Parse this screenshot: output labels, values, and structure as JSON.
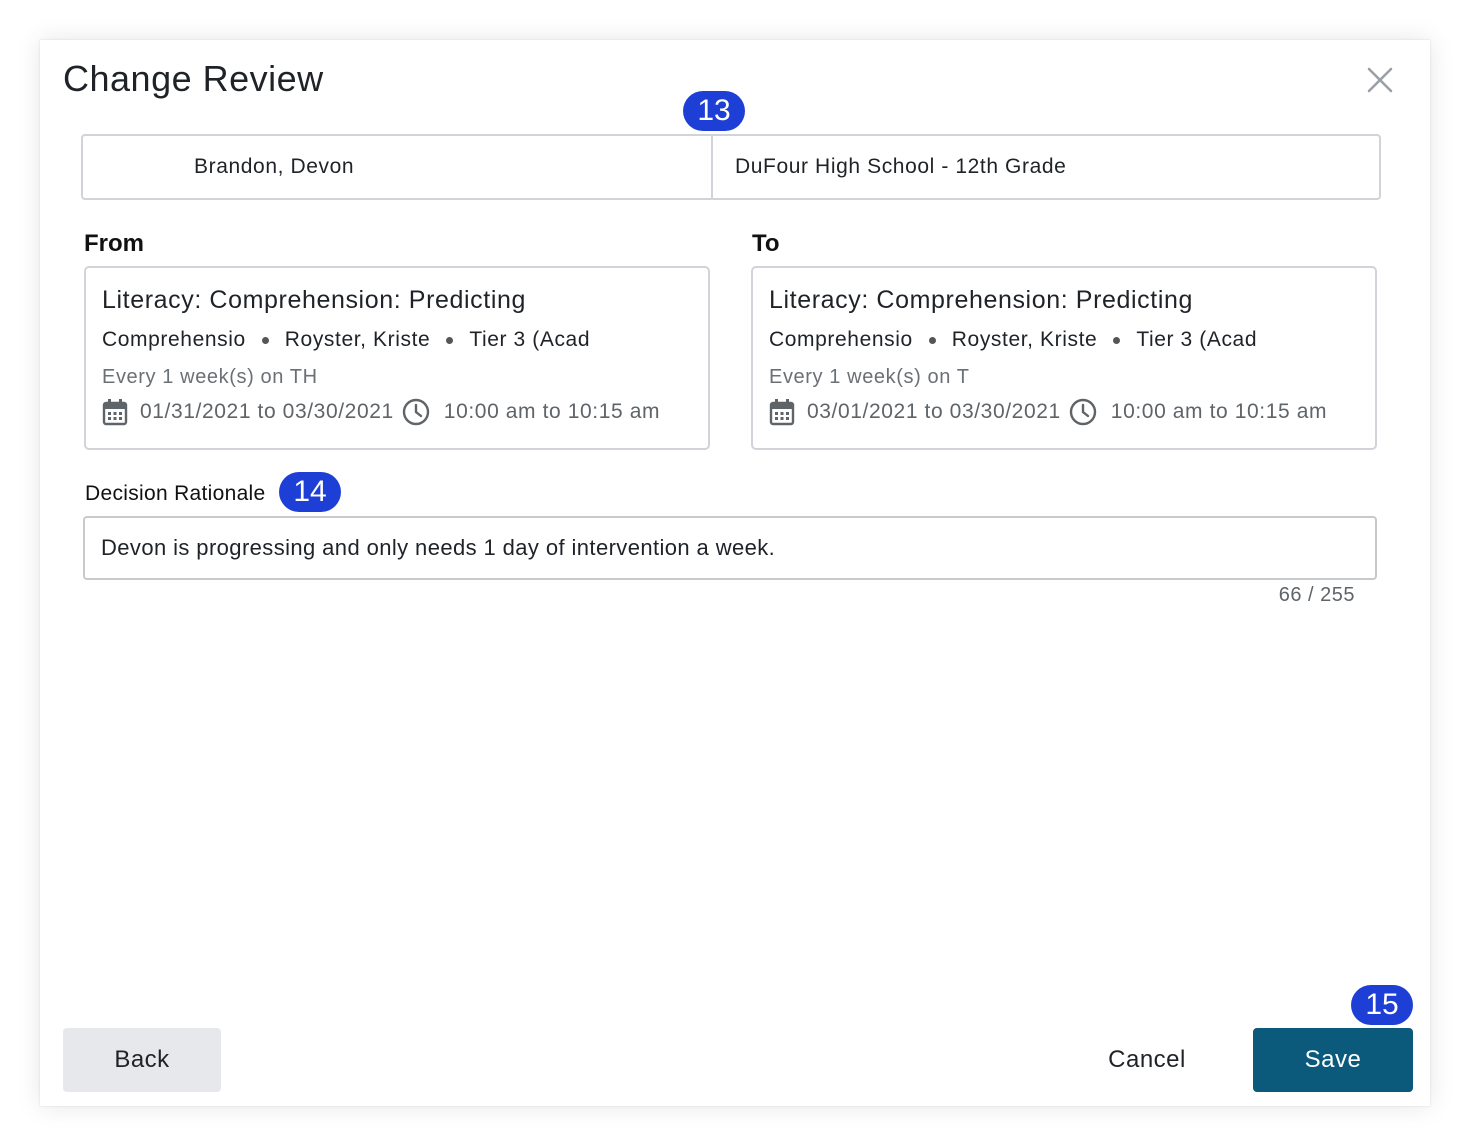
{
  "modal": {
    "title": "Change Review",
    "close_icon": "close-icon"
  },
  "badges": {
    "student_bar": "13",
    "rationale": "14",
    "save": "15",
    "color": "#1d3fd6"
  },
  "student": {
    "name": "Brandon, Devon",
    "school": "DuFour High School - 12th Grade"
  },
  "from": {
    "label": "From",
    "intervention": "Literacy: Comprehension: Predicting",
    "meta": [
      "Comprehensio",
      "Royster, Kriste",
      "Tier 3 (Acad"
    ],
    "frequency": "Every 1 week(s) on TH",
    "date_range": "01/31/2021 to 03/30/2021",
    "time_range": "10:00 am to 10:15 am"
  },
  "to": {
    "label": "To",
    "intervention": "Literacy: Comprehension: Predicting",
    "meta": [
      "Comprehensio",
      "Royster, Kriste",
      "Tier 3 (Acad"
    ],
    "frequency": "Every 1 week(s) on T",
    "date_range": "03/01/2021 to 03/30/2021",
    "time_range": "10:00 am to 10:15 am"
  },
  "rationale": {
    "label": "Decision Rationale",
    "value": "Devon is progressing and only needs 1 day of intervention a week.",
    "counter": "66 / 255"
  },
  "footer": {
    "back_label": "Back",
    "cancel_label": "Cancel",
    "save_label": "Save",
    "save_color": "#0b5a7c"
  }
}
